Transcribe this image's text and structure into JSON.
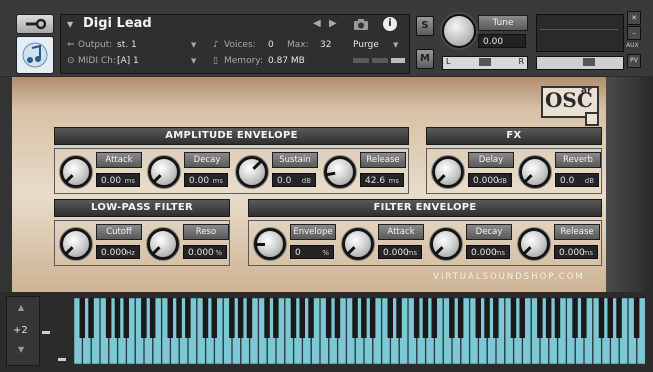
{
  "header": {
    "instrument_name": "Digi Lead",
    "output_label": "Output:",
    "output_value": "st. 1",
    "midi_label": "MIDI Ch:",
    "midi_value": "[A] 1",
    "voices_label": "Voices:",
    "voices_value": "0",
    "max_label": "Max:",
    "max_value": "32",
    "memory_label": "Memory:",
    "memory_value": "0.87 MB",
    "purge_label": "Purge",
    "solo_label": "S",
    "mute_label": "M",
    "tune_label": "Tune",
    "tune_value": "0.00",
    "pan_l": "L",
    "pan_r": "R",
    "aux_label": "AUX",
    "pv_label": "PV"
  },
  "sections": {
    "amp": {
      "title": "AMPLITUDE ENVELOPE",
      "params": [
        {
          "label": "Attack",
          "value": "0.00",
          "unit": "ms"
        },
        {
          "label": "Decay",
          "value": "0.00",
          "unit": "ms"
        },
        {
          "label": "Sustain",
          "value": "0.0",
          "unit": "dB"
        },
        {
          "label": "Release",
          "value": "42.6",
          "unit": "ms"
        }
      ]
    },
    "fx": {
      "title": "FX",
      "params": [
        {
          "label": "Delay",
          "value": "0.000",
          "unit": "dB"
        },
        {
          "label": "Reverb",
          "value": "0.0",
          "unit": "dB"
        }
      ]
    },
    "lpf": {
      "title": "LOW-PASS FILTER",
      "params": [
        {
          "label": "Cutoff",
          "value": "0.000",
          "unit": "Hz"
        },
        {
          "label": "Reso",
          "value": "0.000",
          "unit": "%"
        }
      ]
    },
    "fenv": {
      "title": "FILTER ENVELOPE",
      "params": [
        {
          "label": "Envelope",
          "value": "0",
          "unit": "%"
        },
        {
          "label": "Attack",
          "value": "0.000",
          "unit": "ms"
        },
        {
          "label": "Decay",
          "value": "0.000",
          "unit": "ms"
        },
        {
          "label": "Release",
          "value": "0.000",
          "unit": "ms"
        }
      ]
    }
  },
  "branding": {
    "logo_text": "OSC",
    "logo_sup": "ar",
    "footer_url": "VIRTUALSOUNDSHOP.COM"
  },
  "keyboard": {
    "octave_value": "+2",
    "key_color": "#7ec8d6",
    "black_key_color": "#1a1a1a"
  },
  "colors": {
    "panel_top": "#b08e6e",
    "panel_mid": "#e8dcc9",
    "header_bg": "#3a3a3a"
  }
}
